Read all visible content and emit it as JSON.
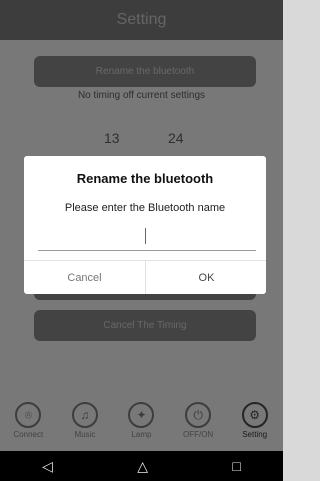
{
  "title": "Setting",
  "rename_button": "Rename the bluetooth",
  "timing_status": "No timing off current settings",
  "time": {
    "hour": "13",
    "minute": "24"
  },
  "cancel_timing": "Cancel The Timing",
  "nav": [
    {
      "label": "Connect",
      "icon": "antenna-icon"
    },
    {
      "label": "Music",
      "icon": "music-icon"
    },
    {
      "label": "Lamp",
      "icon": "bulb-icon"
    },
    {
      "label": "OFF/ON",
      "icon": "power-icon"
    },
    {
      "label": "Setting",
      "icon": "gear-icon"
    }
  ],
  "dialog": {
    "title": "Rename the bluetooth",
    "message": "Please enter the Bluetooth name",
    "input_value": "",
    "cancel": "Cancel",
    "ok": "OK"
  },
  "system_nav": {
    "back": "◁",
    "home": "△",
    "recents": "□"
  }
}
